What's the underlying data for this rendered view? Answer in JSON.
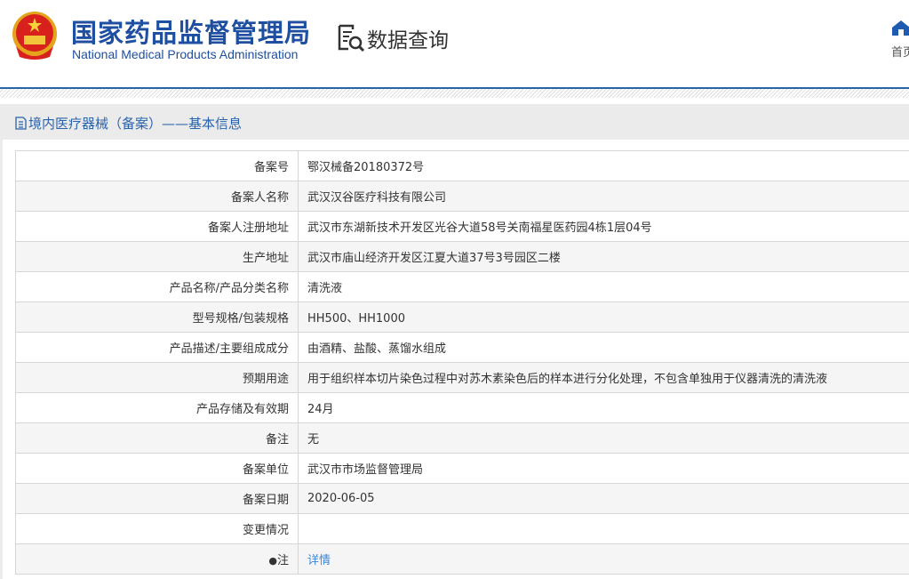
{
  "header": {
    "title_cn": "国家药品监督管理局",
    "title_en": "National Medical Products Administration",
    "query_label": "数据查询",
    "home_label": "首页"
  },
  "section_title": "境内医疗器械（备案）——基本信息",
  "rows": [
    {
      "label": "备案号",
      "value": "鄂汉械备20180372号"
    },
    {
      "label": "备案人名称",
      "value": "武汉汉谷医疗科技有限公司"
    },
    {
      "label": "备案人注册地址",
      "value": "武汉市东湖新技术开发区光谷大道58号关南福星医药园4栋1层04号"
    },
    {
      "label": "生产地址",
      "value": "武汉市庙山经济开发区江夏大道37号3号园区二楼"
    },
    {
      "label": "产品名称/产品分类名称",
      "value": "清洗液"
    },
    {
      "label": "型号规格/包装规格",
      "value": "HH500、HH1000"
    },
    {
      "label": "产品描述/主要组成成分",
      "value": "由酒精、盐酸、蒸馏水组成"
    },
    {
      "label": "预期用途",
      "value": "用于组织样本切片染色过程中对苏木素染色后的样本进行分化处理，不包含单独用于仪器清洗的清洗液"
    },
    {
      "label": "产品存储及有效期",
      "value": "24月"
    },
    {
      "label": "备注",
      "value": "无"
    },
    {
      "label": "备案单位",
      "value": "武汉市市场监督管理局"
    },
    {
      "label": "备案日期",
      "value": "2020-06-05"
    },
    {
      "label": "变更情况",
      "value": ""
    }
  ],
  "note": {
    "label": "注",
    "link": "详情"
  }
}
